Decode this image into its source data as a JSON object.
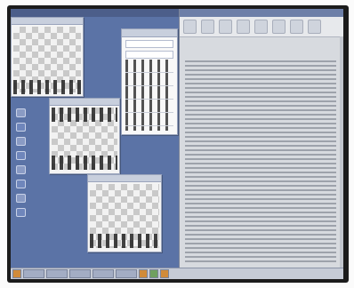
{
  "menubar": {
    "items": [
      "",
      "",
      "",
      "",
      "",
      ""
    ]
  },
  "document": {
    "title": "",
    "heading": ""
  },
  "taskbar": {
    "clock": ""
  }
}
